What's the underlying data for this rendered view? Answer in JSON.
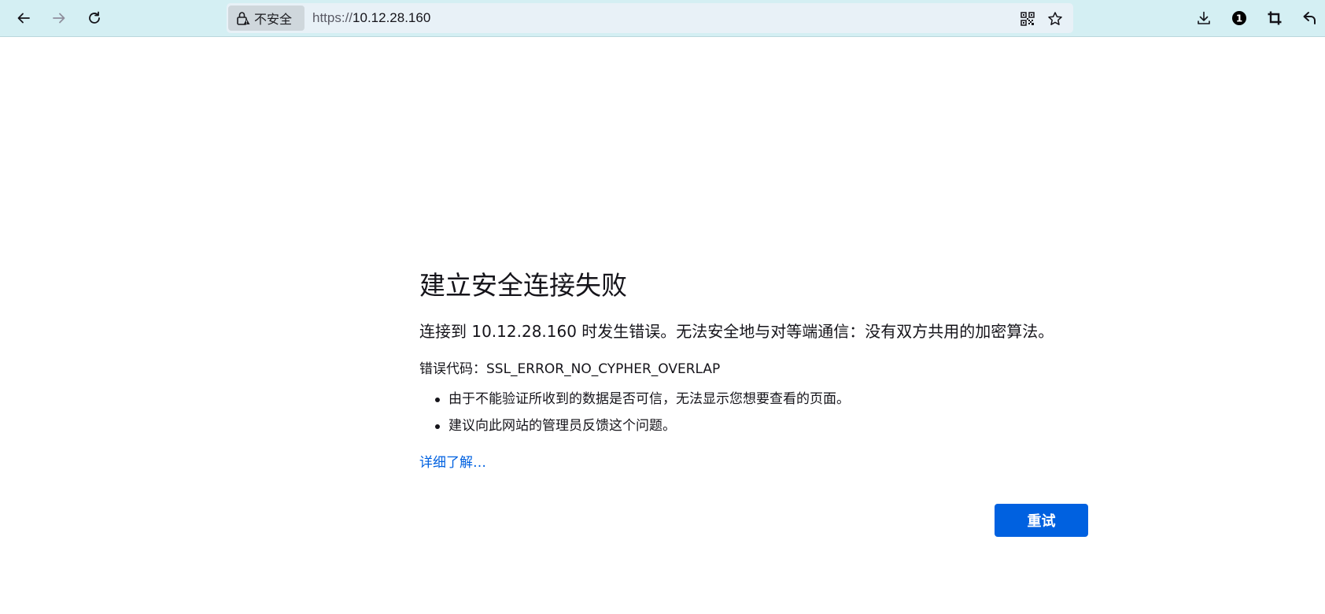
{
  "urlbar": {
    "security_label": "不安全",
    "url_scheme": "https://",
    "url_host": "10.12.28.160"
  },
  "toolbar": {
    "notification_count": "1"
  },
  "error": {
    "title": "建立安全连接失败",
    "short_desc": "连接到 10.12.28.160 时发生错误。无法安全地与对等端通信：没有双方共用的加密算法。",
    "error_code": "错误代码：SSL_ERROR_NO_CYPHER_OVERLAP",
    "bullets": [
      "由于不能验证所收到的数据是否可信，无法显示您想要查看的页面。",
      "建议向此网站的管理员反馈这个问题。"
    ],
    "learn_more": "详细了解…",
    "retry_label": "重试"
  },
  "colors": {
    "toolbar_bg": "#d4eff3",
    "accent": "#0061e0"
  }
}
